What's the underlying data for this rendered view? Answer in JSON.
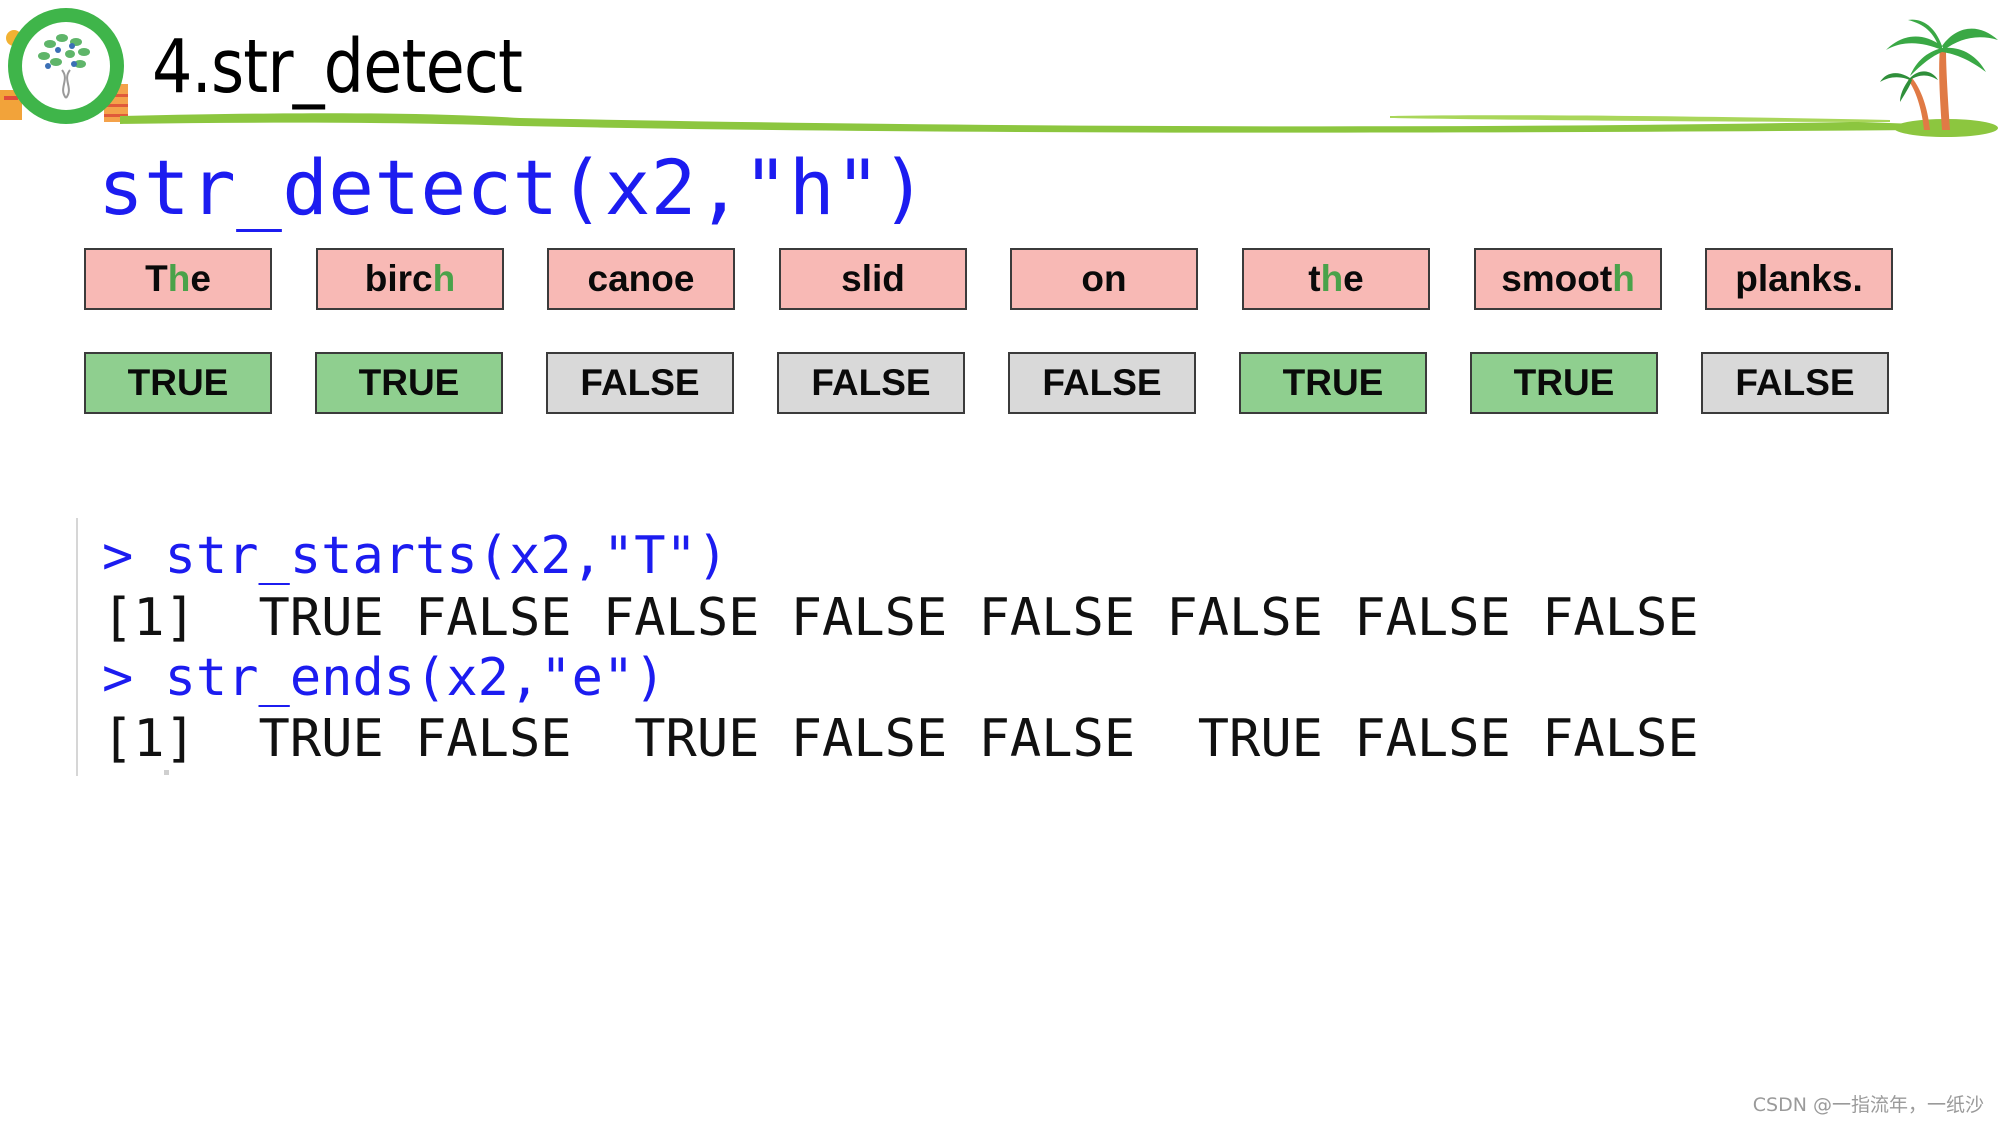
{
  "slide": {
    "title": "4.str_detect",
    "logo_icon": "green-tree-badge-logo",
    "decor_icon": "palm-tree-island"
  },
  "main_code": "str_detect(x2,\"h\")",
  "pattern": "h",
  "words": [
    {
      "pre": "T",
      "hl": "h",
      "post": "e",
      "result": "TRUE"
    },
    {
      "pre": "birc",
      "hl": "h",
      "post": "",
      "result": "TRUE"
    },
    {
      "pre": "canoe",
      "hl": "",
      "post": "",
      "result": "FALSE"
    },
    {
      "pre": "slid",
      "hl": "",
      "post": "",
      "result": "FALSE"
    },
    {
      "pre": "on",
      "hl": "",
      "post": "",
      "result": "FALSE"
    },
    {
      "pre": "t",
      "hl": "h",
      "post": "e",
      "result": "TRUE"
    },
    {
      "pre": "smoot",
      "hl": "h",
      "post": "",
      "result": "TRUE"
    },
    {
      "pre": "planks.",
      "hl": "",
      "post": "",
      "result": "FALSE"
    }
  ],
  "colors": {
    "code_blue": "#1c1cf0",
    "word_box": "#f8b9b5",
    "true_box": "#8fcf8f",
    "false_box": "#d9d9d9",
    "highlight": "#4aa24a",
    "divider_green": "#8cc63f"
  },
  "console": {
    "lines": [
      {
        "type": "cmd",
        "text": "> str_starts(x2,\"T\")"
      },
      {
        "type": "out",
        "text": "[1]  TRUE FALSE FALSE FALSE FALSE FALSE FALSE FALSE"
      },
      {
        "type": "cmd",
        "text": "> str_ends(x2,\"e\")"
      },
      {
        "type": "out",
        "text": "[1]  TRUE FALSE  TRUE FALSE FALSE  TRUE FALSE FALSE"
      }
    ]
  },
  "watermark": "CSDN @一指流年，一纸沙"
}
